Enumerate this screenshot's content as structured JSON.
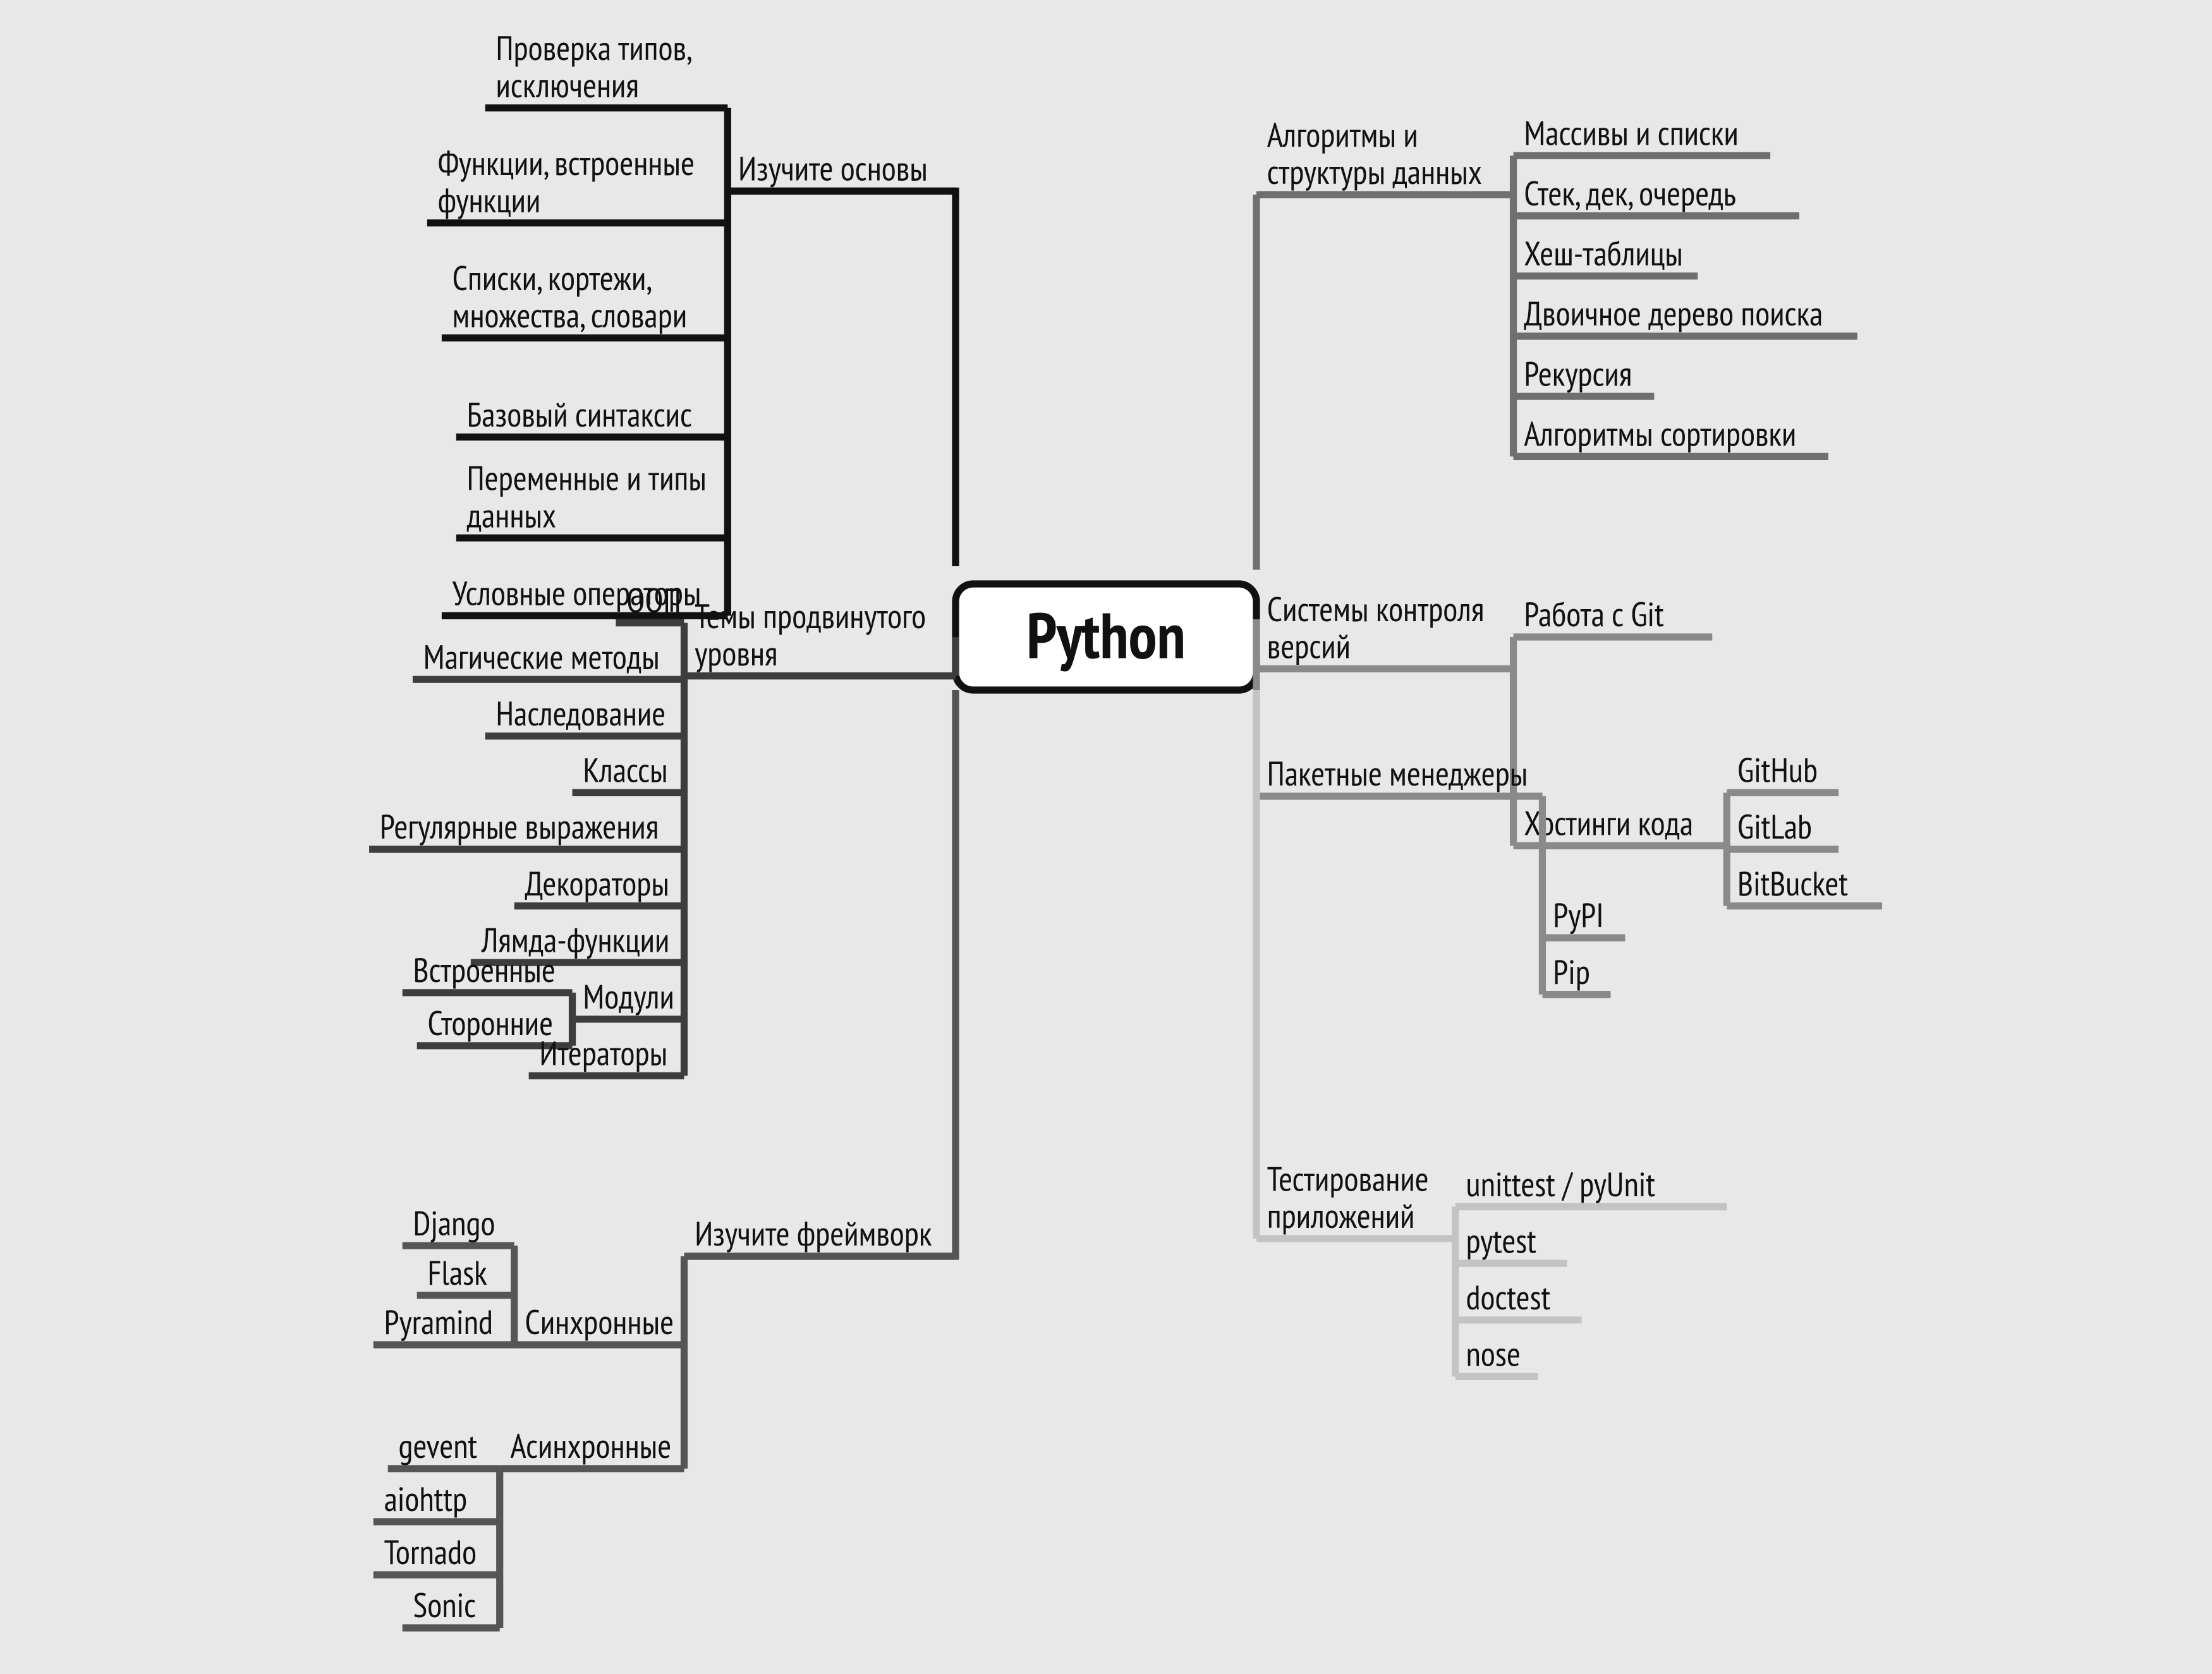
{
  "root": "Python",
  "colors": {
    "c0": "#111111",
    "c1": "#2a2a2a",
    "c2": "#3d3d3d",
    "c3": "#555555",
    "c4": "#6f6f6f",
    "c5": "#8a8a8a",
    "c6": "#a7a7a7",
    "c7": "#c3c3c3"
  },
  "left": [
    {
      "label": "Изучите основы",
      "colorKey": "c0",
      "children": [
        {
          "label": "Проверка типов,\nисключения"
        },
        {
          "label": "Функции, встроенные\nфункции"
        },
        {
          "label": "Списки, кортежи,\nмножества, словари"
        },
        {
          "label": "Базовый синтаксис"
        },
        {
          "label": "Переменные и типы\nданных"
        },
        {
          "label": "Условные операторы"
        }
      ]
    },
    {
      "label": "Темы продвинутого\nуровня",
      "colorKey": "c2",
      "children": [
        {
          "label": "ООП"
        },
        {
          "label": "Магические методы"
        },
        {
          "label": "Наследование"
        },
        {
          "label": "Классы"
        },
        {
          "label": "Регулярные выражения"
        },
        {
          "label": "Декораторы"
        },
        {
          "label": "Лямда-функции"
        },
        {
          "label": "Модули",
          "children": [
            {
              "label": "Встроенные"
            },
            {
              "label": "Сторонние"
            }
          ]
        },
        {
          "label": "Итераторы"
        }
      ]
    },
    {
      "label": "Изучите фреймворк",
      "colorKey": "c3",
      "children": [
        {
          "label": "Синхронные",
          "children": [
            {
              "label": "Django"
            },
            {
              "label": "Flask"
            },
            {
              "label": "Pyramind"
            }
          ]
        },
        {
          "label": "Асинхронные",
          "children": [
            {
              "label": "gevent"
            },
            {
              "label": "aiohttp"
            },
            {
              "label": "Tornado"
            },
            {
              "label": "Sonic"
            }
          ]
        }
      ]
    }
  ],
  "right": [
    {
      "label": "Алгоритмы и\nструктуры данных",
      "colorKey": "c4",
      "children": [
        {
          "label": "Массивы и списки"
        },
        {
          "label": "Стек, дек, очередь"
        },
        {
          "label": "Хеш-таблицы"
        },
        {
          "label": "Двоичное дерево поиска"
        },
        {
          "label": "Рекурсия"
        },
        {
          "label": "Алгоритмы сортировки"
        }
      ]
    },
    {
      "label": "Системы контроля\nверсий",
      "colorKey": "c5",
      "children": [
        {
          "label": "Работа с Git"
        },
        {
          "label": "Хостинги кода",
          "children": [
            {
              "label": "GitHub"
            },
            {
              "label": "GitLab"
            },
            {
              "label": "BitBucket"
            }
          ]
        }
      ]
    },
    {
      "label": "Пакетные менеджеры",
      "colorKey": "c5",
      "inline": true,
      "children": [
        {
          "label": "PyPI"
        },
        {
          "label": "Pip"
        }
      ]
    },
    {
      "label": "Тестирование\nприложений",
      "colorKey": "c7",
      "children": [
        {
          "label": "unittest / pyUnit"
        },
        {
          "label": "pytest"
        },
        {
          "label": "doctest"
        },
        {
          "label": "nose"
        }
      ]
    }
  ]
}
